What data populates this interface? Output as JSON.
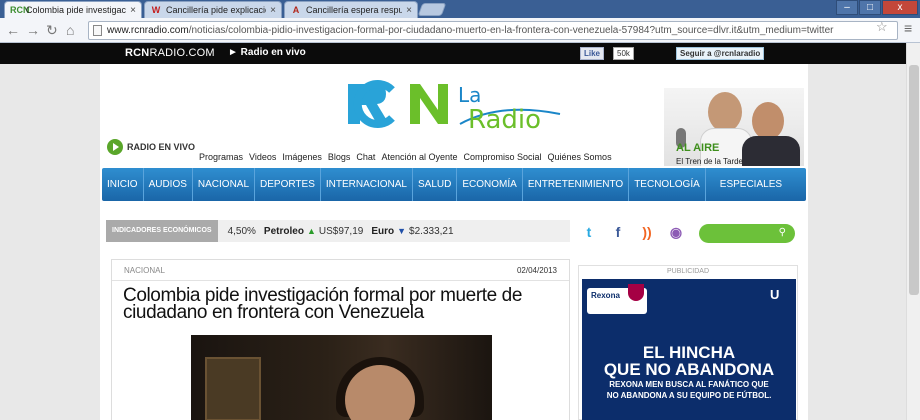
{
  "browser": {
    "tabs": [
      {
        "label": "Colombia pide investigación f",
        "close": "×",
        "favicon": "RCN"
      },
      {
        "label": "Cancillería pide explicaciones",
        "close": "×",
        "favicon": "W"
      },
      {
        "label": "Cancillería espera respuesta",
        "close": "×",
        "favicon": "A"
      }
    ],
    "window_buttons": {
      "minimize": "–",
      "maximize": "□",
      "close": "x"
    },
    "nav_icons": {
      "back": "back-arrow-icon",
      "forward": "forward-arrow-icon",
      "reload": "reload-icon",
      "home": "home-icon"
    },
    "url": {
      "host": "www.rcnradio.com",
      "path": "/noticias/colombia-pidio-investigacion-formal-por-ciudadano-muerto-en-la-frontera-con-venezuela-57984?utm_source=dlvr.it&utm_medium=twitter"
    }
  },
  "site_bar": {
    "brand_bold": "RCN",
    "brand_thin": "RADIO.COM",
    "live_label": "► Radio en vivo",
    "fb_like": "Like",
    "fb_count": "50k",
    "twitter_follow": "Seguir a @rcnlaradio"
  },
  "header": {
    "logo_text_1": "La",
    "logo_text_2": "Radio",
    "radio_live": "RADIO EN VIVO",
    "subnav": [
      "Programas",
      "Videos",
      "Imágenes",
      "Blogs",
      "Chat",
      "Atención al Oyente",
      "Compromiso Social",
      "Quiénes Somos"
    ],
    "al_aire": "AL AIRE",
    "show_name": "El Tren de la Tarde"
  },
  "main_nav": [
    "INICIO",
    "AUDIOS",
    "NACIONAL",
    "DEPORTES",
    "INTERNACIONAL",
    "SALUD",
    "ECONOMÍA",
    "ENTRETENIMIENTO",
    "TECNOLOGÍA",
    "ESPECIALES"
  ],
  "indicators": {
    "label": "INDICADORES ECONÓMICOS",
    "rate": "4,50%",
    "oil_label": "Petroleo",
    "oil_value": "US$97,19",
    "euro_label": "Euro",
    "euro_value": "$2.333,21"
  },
  "social_icons": [
    "twitter-icon",
    "facebook-icon",
    "rss-icon",
    "podcast-icon"
  ],
  "article": {
    "category": "NACIONAL",
    "date": "02/04/2013",
    "headline": "Colombia pide investigación formal por muerte de ciudadano en frontera con Venezuela"
  },
  "ad": {
    "label": "PUBLICIDAD",
    "brand": "Rexona",
    "headline_1": "EL HINCHA",
    "headline_2": "QUE NO ABANDONA",
    "sub_1": "REXONA MEN BUSCA AL FANÁTICO QUE",
    "sub_2": "NO ABANDONA A SU EQUIPO DE FÚTBOL.",
    "brand_colors": {
      "blue": "#0c2d6b",
      "green": "#6cc13a",
      "nav_blue": "#1f78bf"
    }
  }
}
